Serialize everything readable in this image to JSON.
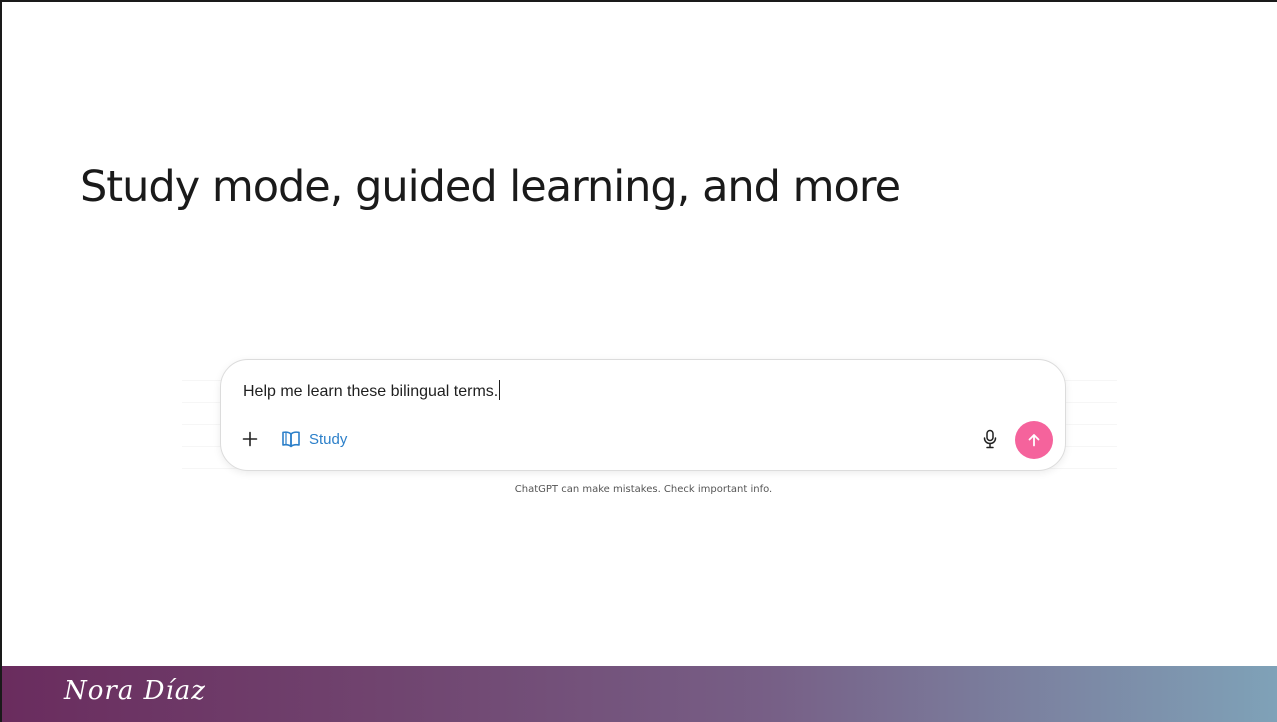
{
  "slide": {
    "title": "Study mode, guided learning, and more"
  },
  "composer": {
    "prompt_text": "Help me learn these bilingual terms.",
    "tool_label": "Study",
    "icons": {
      "plus": "plus-icon",
      "tool": "book-open-icon",
      "mic": "microphone-icon",
      "send": "arrow-up-icon"
    },
    "send_color": "#f5639c",
    "tool_color": "#2b7fc9"
  },
  "disclaimer": "ChatGPT can make mistakes. Check important info.",
  "footer": {
    "author": "Nora Díaz"
  }
}
